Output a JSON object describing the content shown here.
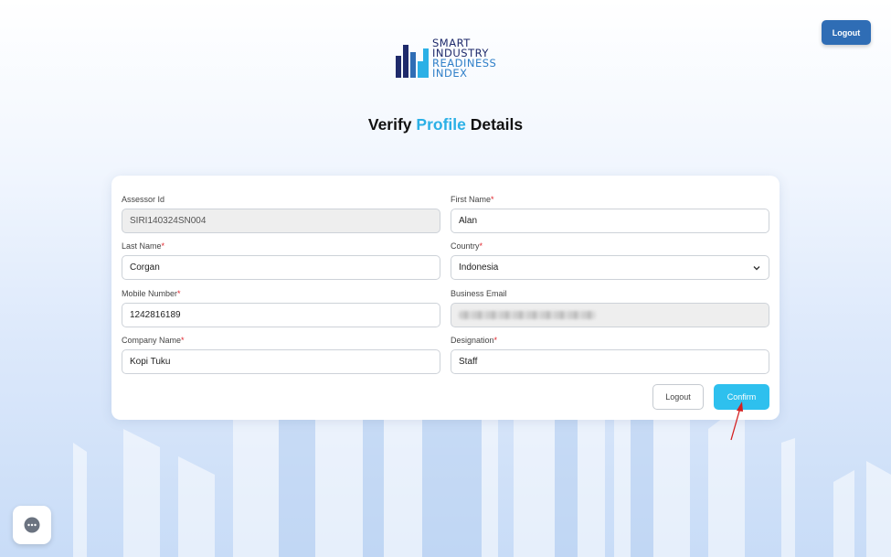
{
  "header": {
    "logout_label": "Logout",
    "logo": {
      "line1": "SMART",
      "line2": "INDUSTRY",
      "line3": "READINESS",
      "line4": "INDEX"
    }
  },
  "title": {
    "part1": "Verify ",
    "accent": "Profile",
    "part2": " Details"
  },
  "form": {
    "assessor_id": {
      "label": "Assessor Id",
      "value": "SIRI140324SN004"
    },
    "first_name": {
      "label": "First Name",
      "required": "*",
      "value": "Alan"
    },
    "last_name": {
      "label": "Last Name",
      "required": "*",
      "value": "Corgan"
    },
    "country": {
      "label": "Country",
      "required": "*",
      "value": "Indonesia"
    },
    "mobile": {
      "label": "Mobile Number",
      "required": "*",
      "value": "1242816189"
    },
    "business_email": {
      "label": "Business Email"
    },
    "company": {
      "label": "Company Name",
      "required": "*",
      "value": "Kopi Tuku"
    },
    "designation": {
      "label": "Designation",
      "required": "*",
      "value": "Staff"
    }
  },
  "actions": {
    "logout_label": "Logout",
    "confirm_label": "Confirm"
  },
  "colors": {
    "accent": "#2bb0e6",
    "primary_button": "#2f6db5",
    "confirm_button": "#2ec0ee",
    "required": "#e0252d",
    "annotation_arrow": "#d42020"
  },
  "icons": {
    "chat": "chat-icon",
    "dropdown": "chevron-down-icon",
    "logo": "logo-bars-icon"
  }
}
